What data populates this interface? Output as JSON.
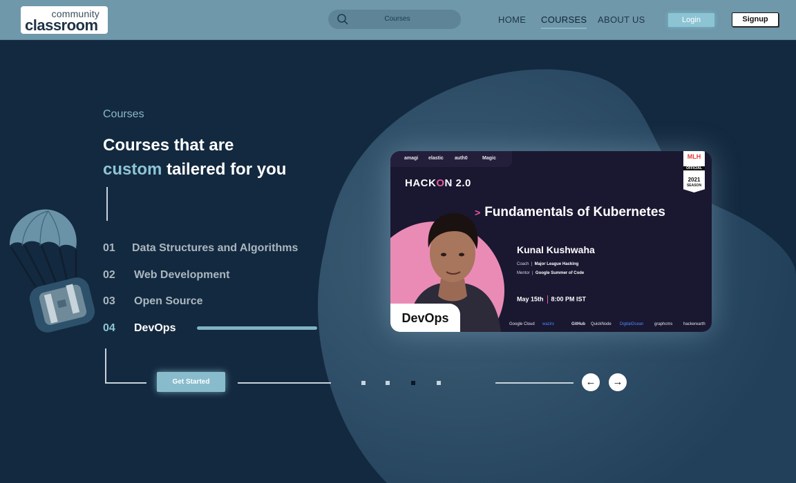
{
  "header": {
    "logo_top": "community",
    "logo_bottom": "classroom",
    "search_placeholder": "Courses",
    "nav": [
      "HOME",
      "COURSES",
      "ABOUT US"
    ],
    "active_nav": "COURSES",
    "login_label": "Login",
    "signup_label": "Signup"
  },
  "hero": {
    "eyebrow": "Courses",
    "heading_line1": "Courses that are",
    "heading_accent": "custom",
    "heading_line2_rest": " tailered for you",
    "courses": [
      {
        "num": "01",
        "name": "Data Structures and Algorithms"
      },
      {
        "num": "02",
        "name": "Web Development"
      },
      {
        "num": "03",
        "name": "Open Source"
      },
      {
        "num": "04",
        "name": "DevOps"
      }
    ],
    "active_course": 4,
    "cta_label": "Get Started",
    "slider": {
      "total": 4,
      "active": 3
    },
    "prev_arrow": "←",
    "next_arrow": "→"
  },
  "card": {
    "sponsors_top": [
      "amagi",
      "elastic",
      "auth0",
      "Magic"
    ],
    "badge": {
      "org": "MLH",
      "label": "OFFICIAL",
      "year": "2021",
      "season": "SEASON"
    },
    "event_prefix": "HACK",
    "event_o": "O",
    "event_suffix": "N 2.0",
    "title_marker": ">",
    "title": "Fundamentals of Kubernetes",
    "speaker": "Kunal Kushwaha",
    "role1_label": "Coach",
    "role1_org": "Major League Hacking",
    "role2_label": "Mentor",
    "role2_org": "Google Summer of Code",
    "date": "May 15th",
    "time": "8:00 PM IST",
    "tag": "DevOps",
    "sponsors_bottom": [
      "Google Cloud",
      "wazirx",
      "GitHub",
      "QuickNode",
      "DigitalOcean",
      "graphcms",
      "hackerearth"
    ]
  },
  "colors": {
    "background": "#13293f",
    "header": "#6f98aa",
    "accent": "#8ec5d6",
    "pink": "#e65c9c"
  }
}
